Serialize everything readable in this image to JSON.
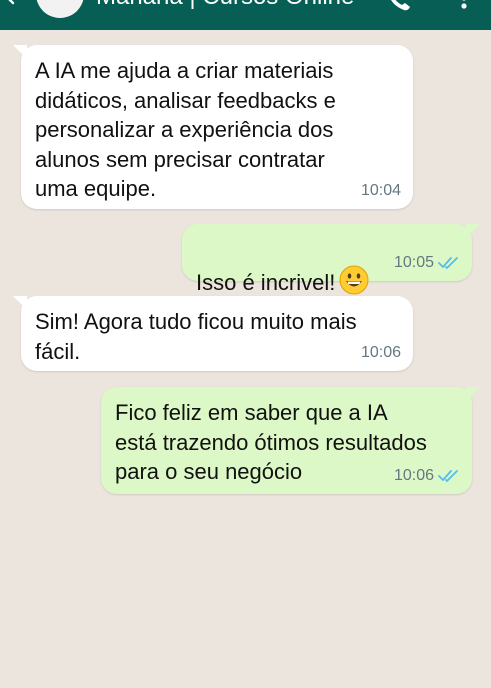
{
  "header": {
    "title": "Mariana | Cursos Online",
    "back_icon": "arrow-left-icon",
    "call_icon": "phone-icon",
    "menu_icon": "more-vertical-icon",
    "color": "#075e54"
  },
  "messages": [
    {
      "direction": "incoming",
      "text": "A IA me ajuda a criar materiais\ndidáticos, analisar feedbacks e\npersonalizar a experiência dos\nalunos sem precisar contratar\numa equipe.",
      "time": "10:04"
    },
    {
      "direction": "outgoing",
      "text": "Isso é incrivel!",
      "emoji": "grinning-face-emoji",
      "time": "10:05",
      "status": "read-double-check"
    },
    {
      "direction": "incoming",
      "text": "Sim! Agora tudo ficou muito mais\nfácil.",
      "time": "10:06"
    },
    {
      "direction": "outgoing",
      "text": "Fico feliz em saber que a IA\nestá trazendo ótimos resultados\npara o seu negócio",
      "time": "10:06",
      "status": "read-double-check"
    }
  ],
  "colors": {
    "chat_background": "#ece5dd",
    "incoming_bubble": "#ffffff",
    "outgoing_bubble": "#dcf8c6",
    "read_ticks": "#53bdeb"
  }
}
